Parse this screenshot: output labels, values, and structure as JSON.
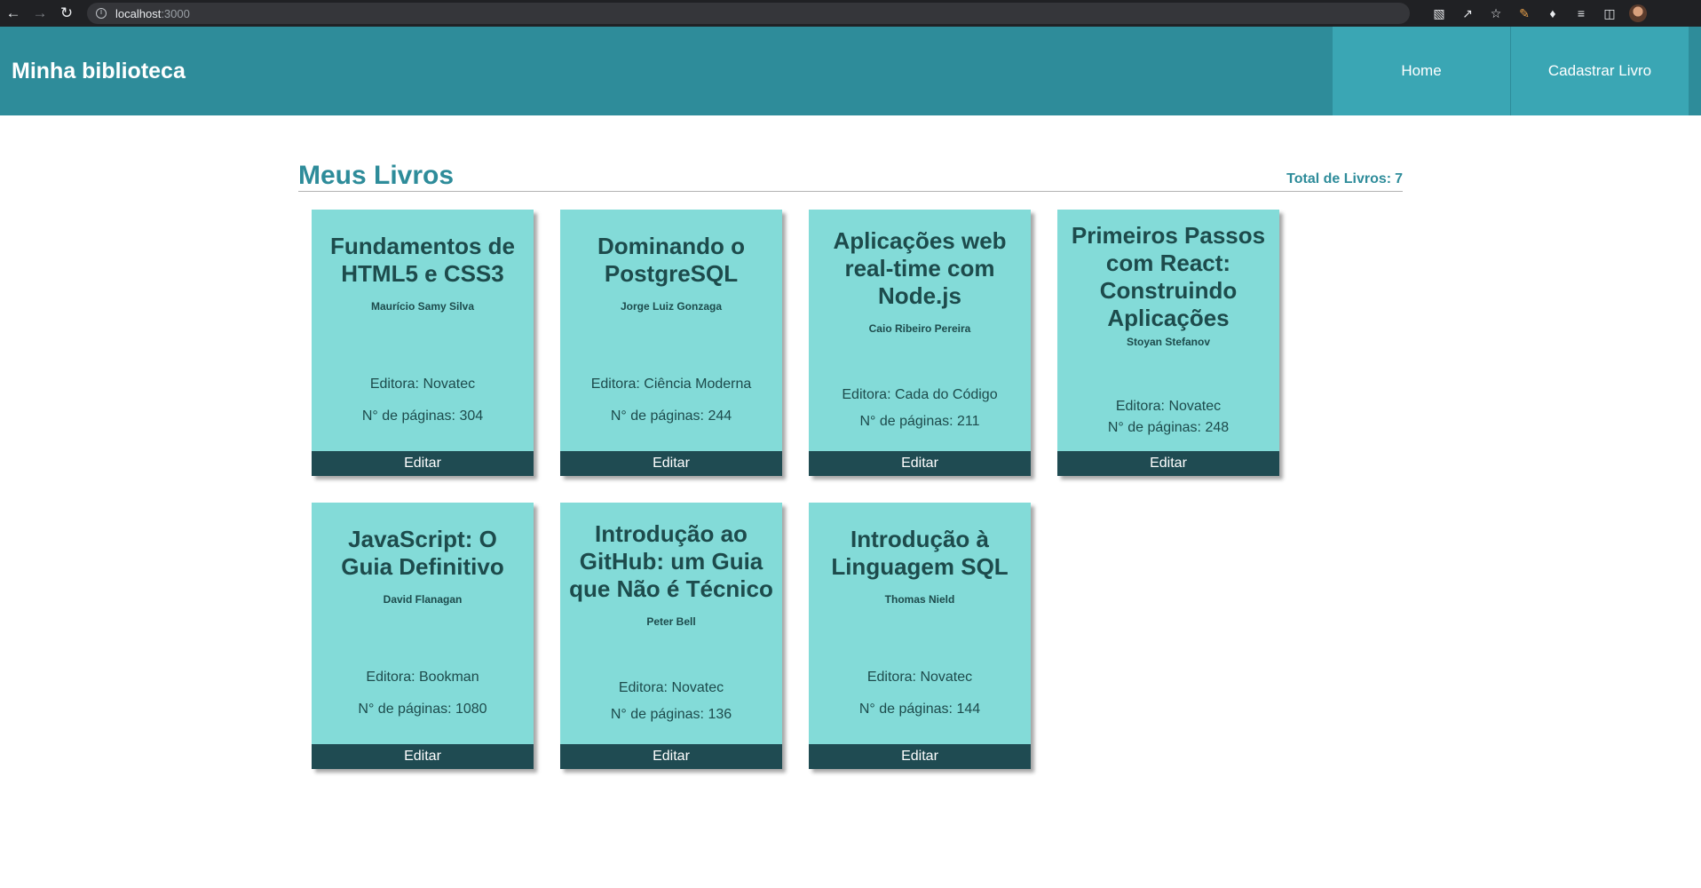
{
  "browser": {
    "url_host": "localhost",
    "url_port": ":3000"
  },
  "header": {
    "title": "Minha biblioteca",
    "nav": [
      "Home",
      "Cadastrar Livro"
    ]
  },
  "main": {
    "title": "Meus Livros",
    "total_label": "Total de Livros:",
    "total_value": "7",
    "edit_label": "Editar",
    "books": [
      {
        "title": "Fundamentos de HTML5 e CSS3",
        "author": "Maurício Samy Silva",
        "publisher": "Editora: Novatec",
        "pages": "N° de páginas: 304"
      },
      {
        "title": "Dominando o PostgreSQL",
        "author": "Jorge Luiz Gonzaga",
        "publisher": "Editora: Ciência Moderna",
        "pages": "N° de páginas: 244"
      },
      {
        "title": "Aplicações web real-time com Node.js",
        "author": "Caio Ribeiro Pereira",
        "publisher": "Editora: Cada do Código",
        "pages": "N° de páginas: 211"
      },
      {
        "title": "Primeiros Passos com React: Construindo Aplicações",
        "author": "Stoyan Stefanov",
        "publisher": "Editora: Novatec",
        "pages": "N° de páginas: 248"
      },
      {
        "title": "JavaScript: O Guia Definitivo",
        "author": "David Flanagan",
        "publisher": "Editora: Bookman",
        "pages": "N° de páginas: 1080"
      },
      {
        "title": "Introdução ao GitHub: um Guia que Não é Técnico",
        "author": "Peter Bell",
        "publisher": "Editora: Novatec",
        "pages": "N° de páginas: 136"
      },
      {
        "title": "Introdução à Linguagem SQL",
        "author": "Thomas Nield",
        "publisher": "Editora: Novatec",
        "pages": "N° de páginas: 144"
      }
    ]
  },
  "colors": {
    "header_bg": "#2e8c9a",
    "nav_bg": "#3aa6b4",
    "card_bg": "#83dbd8",
    "button_bg": "#1f4b52",
    "text_dark": "#1d4b4c"
  },
  "icons": [
    "back-icon",
    "forward-icon",
    "reload-icon",
    "info-icon",
    "translate-icon",
    "share-icon",
    "star-icon",
    "pen-icon",
    "puzzle-icon",
    "playlist-icon",
    "sidepanel-icon",
    "avatar"
  ]
}
